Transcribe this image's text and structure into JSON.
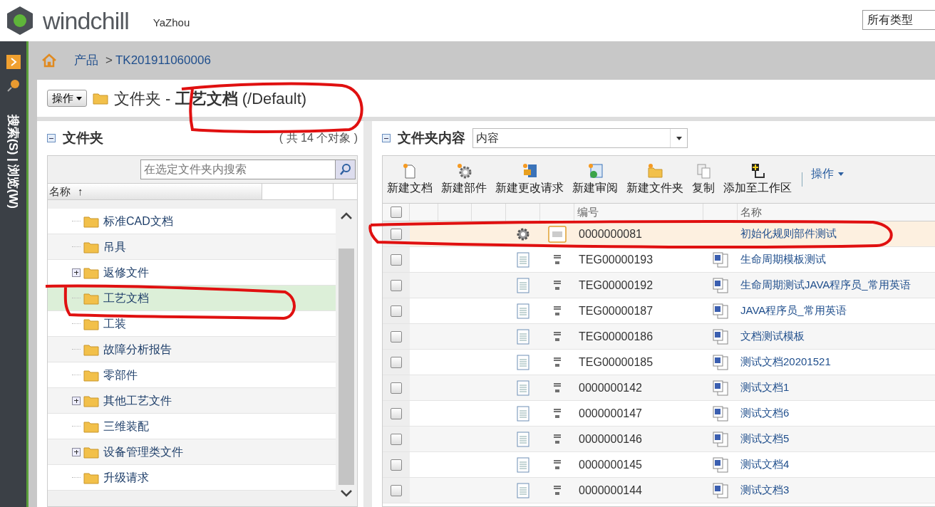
{
  "header": {
    "logo_text": "windchill",
    "user": "YaZhou",
    "type_select": "所有类型"
  },
  "sidebar": {
    "label": "搜索(S) | 浏览(W)"
  },
  "breadcrumb": {
    "items": [
      "产品",
      "TK201911060006"
    ],
    "separator": ">"
  },
  "page_title": {
    "actions_button": "操作",
    "prefix": "文件夹 - ",
    "name": "工艺文档",
    "path": "(/Default)"
  },
  "folders_panel": {
    "title": "文件夹",
    "count": "( 共 14 个对象 )",
    "search_placeholder": "在选定文件夹内搜索",
    "column": "名称",
    "sort_mark": "↑",
    "items": [
      {
        "label": "标准CAD文档",
        "expandable": false,
        "selected": false
      },
      {
        "label": "吊具",
        "expandable": false,
        "selected": false
      },
      {
        "label": "返修文件",
        "expandable": true,
        "selected": false
      },
      {
        "label": "工艺文档",
        "expandable": false,
        "selected": true
      },
      {
        "label": "工装",
        "expandable": false,
        "selected": false
      },
      {
        "label": "故障分析报告",
        "expandable": false,
        "selected": false
      },
      {
        "label": "零部件",
        "expandable": false,
        "selected": false
      },
      {
        "label": "其他工艺文件",
        "expandable": true,
        "selected": false
      },
      {
        "label": "三维装配",
        "expandable": false,
        "selected": false
      },
      {
        "label": "设备管理类文件",
        "expandable": true,
        "selected": false
      },
      {
        "label": "升级请求",
        "expandable": false,
        "selected": false
      }
    ]
  },
  "contents_panel": {
    "title": "文件夹内容",
    "view_select": "内容",
    "toolbar": [
      {
        "label": "新建文档",
        "kind": "new-doc"
      },
      {
        "label": "新建部件",
        "kind": "new-part"
      },
      {
        "label": "新建更改请求",
        "kind": "new-change"
      },
      {
        "label": "新建审阅",
        "kind": "new-review"
      },
      {
        "label": "新建文件夹",
        "kind": "new-folder"
      },
      {
        "label": "复制",
        "kind": "copy"
      },
      {
        "label": "添加至工作区",
        "kind": "add-workspace"
      }
    ],
    "actions_menu": "操作",
    "columns": {
      "number": "编号",
      "name": "名称",
      "select_all_checked": false
    },
    "rows": [
      {
        "kind": "part",
        "number": "0000000081",
        "name": "初始化规则部件测试",
        "selected": true,
        "checked": false
      },
      {
        "kind": "document",
        "number": "TEG00000193",
        "name": "生命周期模板测试",
        "selected": false,
        "checked": false
      },
      {
        "kind": "document",
        "number": "TEG00000192",
        "name": "生命周期测试JAVA程序员_常用英语",
        "selected": false,
        "checked": false
      },
      {
        "kind": "document",
        "number": "TEG00000187",
        "name": "JAVA程序员_常用英语",
        "selected": false,
        "checked": false
      },
      {
        "kind": "document",
        "number": "TEG00000186",
        "name": "文档测试模板",
        "selected": false,
        "checked": false
      },
      {
        "kind": "document",
        "number": "TEG00000185",
        "name": "测试文档20201521",
        "selected": false,
        "checked": false
      },
      {
        "kind": "document",
        "number": "0000000142",
        "name": "测试文档1",
        "selected": false,
        "checked": false
      },
      {
        "kind": "document",
        "number": "0000000147",
        "name": "测试文档6",
        "selected": false,
        "checked": false
      },
      {
        "kind": "document",
        "number": "0000000146",
        "name": "测试文档5",
        "selected": false,
        "checked": false
      },
      {
        "kind": "document",
        "number": "0000000145",
        "name": "测试文档4",
        "selected": false,
        "checked": false
      },
      {
        "kind": "document",
        "number": "0000000144",
        "name": "测试文档3",
        "selected": false,
        "checked": false
      }
    ]
  }
}
